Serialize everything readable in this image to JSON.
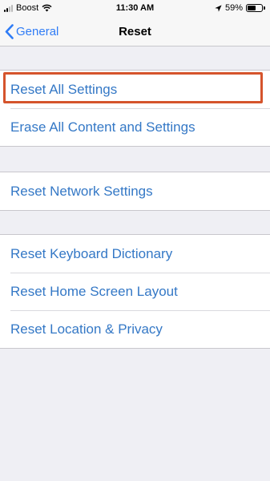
{
  "status_bar": {
    "carrier": "Boost",
    "time": "11:30 AM",
    "battery_percent": "59%",
    "battery_level": 0.59,
    "icons": [
      "signal-icon",
      "wifi-icon",
      "location-icon",
      "battery-icon"
    ]
  },
  "nav": {
    "back_label": "General",
    "title": "Reset"
  },
  "groups": [
    {
      "items": [
        "Reset All Settings",
        "Erase All Content and Settings"
      ]
    },
    {
      "items": [
        "Reset Network Settings"
      ]
    },
    {
      "items": [
        "Reset Keyboard Dictionary",
        "Reset Home Screen Layout",
        "Reset Location & Privacy"
      ]
    }
  ],
  "colors": {
    "accent": "#3478c6",
    "highlight": "#d5542c",
    "background": "#efeff4"
  }
}
